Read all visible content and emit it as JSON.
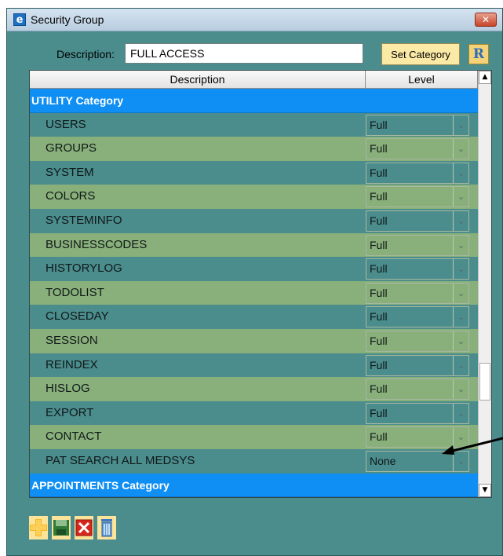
{
  "window": {
    "title": "Security Group",
    "app_icon": "e",
    "close_icon": "close-icon",
    "close_glyph": "✕"
  },
  "form": {
    "description_label": "Description:",
    "description_value": "FULL ACCESS",
    "set_category_label": "Set Category",
    "report_icon_text": "R"
  },
  "grid": {
    "columns": [
      "Description",
      "Level"
    ],
    "dropdown_glyph": "⌄",
    "categories": [
      {
        "label": "UTILITY Category",
        "rows": [
          {
            "label": "USERS",
            "level": "Full"
          },
          {
            "label": "GROUPS",
            "level": "Full"
          },
          {
            "label": "SYSTEM",
            "level": "Full"
          },
          {
            "label": "COLORS",
            "level": "Full"
          },
          {
            "label": "SYSTEMINFO",
            "level": "Full"
          },
          {
            "label": "BUSINESSCODES",
            "level": "Full"
          },
          {
            "label": "HISTORYLOG",
            "level": "Full"
          },
          {
            "label": "TODOLIST",
            "level": "Full"
          },
          {
            "label": "CLOSEDAY",
            "level": "Full"
          },
          {
            "label": "SESSION",
            "level": "Full"
          },
          {
            "label": "REINDEX",
            "level": "Full"
          },
          {
            "label": "HISLOG",
            "level": "Full"
          },
          {
            "label": "EXPORT",
            "level": "Full"
          },
          {
            "label": "CONTACT",
            "level": "Full"
          },
          {
            "label": "PAT SEARCH ALL MEDSYS",
            "level": "None"
          }
        ]
      },
      {
        "label": "APPOINTMENTS Category",
        "rows": []
      }
    ],
    "scrollbar": {
      "up_glyph": "▲",
      "down_glyph": "▼"
    }
  },
  "toolbar": {
    "buttons": [
      {
        "name": "add-button",
        "icon": "plus-icon"
      },
      {
        "name": "save-button",
        "icon": "floppy-disk-icon"
      },
      {
        "name": "delete-button",
        "icon": "red-x-icon"
      },
      {
        "name": "trash-button",
        "icon": "trash-can-icon"
      }
    ]
  },
  "colors": {
    "window_bg": "#4b8c8d",
    "row_alt_bg": "#89b07b",
    "category_bg": "#0f8ff4",
    "set_category_bg": "#fbe9a6"
  }
}
